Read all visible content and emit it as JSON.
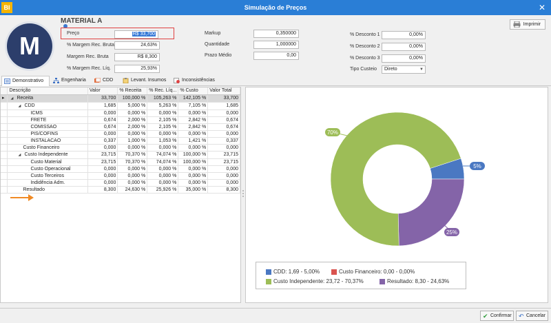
{
  "window": {
    "logo": "BI",
    "title": "Simulação de Preços",
    "close_glyph": "✕"
  },
  "product": {
    "avatar_letter": "M",
    "name": "MATERIAL A"
  },
  "fields": {
    "preco_label": "Preço",
    "preco_value": "R$ 33,700",
    "margem_bruta_pct_label": "% Margem Rec. Bruta",
    "margem_bruta_pct_value": "24,63%",
    "margem_bruta_label": "Margem Rec. Bruta",
    "margem_bruta_value": "R$ 8,300",
    "margem_liq_pct_label": "% Margem Rec. Líq.",
    "margem_liq_pct_value": "25,93%",
    "markup_label": "Markup",
    "markup_value": "0,350000",
    "quantidade_label": "Quantidade",
    "quantidade_value": "1,000000",
    "prazo_label": "Prazo Médio",
    "prazo_value": "0,00",
    "desc1_label": "% Desconto 1",
    "desc1_value": "0,00%",
    "desc2_label": "% Desconto 2",
    "desc2_value": "0,00%",
    "desc3_label": "% Desconto 3",
    "desc3_value": "0,00%",
    "tipo_custeio_label": "Tipo Custeio",
    "tipo_custeio_value": "Direto"
  },
  "toolbar": {
    "print_label": "Imprimir"
  },
  "tabs": [
    {
      "label": "Demonstrativo",
      "icon": "document-icon"
    },
    {
      "label": "Engenharia",
      "icon": "structure-icon"
    },
    {
      "label": "CDD",
      "icon": "cdd-icon"
    },
    {
      "label": "Levant. Insumos",
      "icon": "clipboard-icon"
    },
    {
      "label": "Inconsistências",
      "icon": "warning-doc-icon"
    }
  ],
  "table": {
    "headers": [
      "Descrição",
      "Valor",
      "% Receita",
      "% Rec. Líq...",
      "% Custo",
      "Valor Total"
    ],
    "rows": [
      {
        "level": 0,
        "expand": "◢",
        "cells": [
          "Receita",
          "33,700",
          "100,000 %",
          "105,263 %",
          "142,105 %",
          "33,700"
        ]
      },
      {
        "level": 1,
        "expand": "◢",
        "cells": [
          "CDD",
          "1,685",
          "5,000 %",
          "5,263 %",
          "7,105 %",
          "1,685"
        ]
      },
      {
        "level": 2,
        "expand": "",
        "cells": [
          "ICMS",
          "0,000",
          "0,000 %",
          "0,000 %",
          "0,000 %",
          "0,000"
        ]
      },
      {
        "level": 2,
        "expand": "",
        "cells": [
          "FRETE",
          "0,674",
          "2,000 %",
          "2,105 %",
          "2,842 %",
          "0,674"
        ]
      },
      {
        "level": 2,
        "expand": "",
        "cells": [
          "COMISSAO",
          "0,674",
          "2,000 %",
          "2,105 %",
          "2,842 %",
          "0,674"
        ]
      },
      {
        "level": 2,
        "expand": "",
        "cells": [
          "PIS/COFINS",
          "0,000",
          "0,000 %",
          "0,000 %",
          "0,000 %",
          "0,000"
        ]
      },
      {
        "level": 2,
        "expand": "",
        "cells": [
          "INSTALACAO",
          "0,337",
          "1,000 %",
          "1,053 %",
          "1,421 %",
          "0,337"
        ]
      },
      {
        "level": 1,
        "expand": "",
        "cells": [
          "Custo Financeiro",
          "0,000",
          "0,000 %",
          "0,000 %",
          "0,000 %",
          "0,000"
        ]
      },
      {
        "level": 1,
        "expand": "◢",
        "cells": [
          "Custo Independente",
          "23,715",
          "70,370 %",
          "74,074 %",
          "100,000 %",
          "23,715"
        ]
      },
      {
        "level": 2,
        "expand": "",
        "cells": [
          "Custo Material",
          "23,715",
          "70,370 %",
          "74,074 %",
          "100,000 %",
          "23,715"
        ]
      },
      {
        "level": 2,
        "expand": "",
        "cells": [
          "Custo Operacional",
          "0,000",
          "0,000 %",
          "0,000 %",
          "0,000 %",
          "0,000"
        ]
      },
      {
        "level": 2,
        "expand": "",
        "cells": [
          "Custo Terceiros",
          "0,000",
          "0,000 %",
          "0,000 %",
          "0,000 %",
          "0,000"
        ]
      },
      {
        "level": 2,
        "expand": "",
        "cells": [
          "Indidência Adm.",
          "0,000",
          "0,000 %",
          "0,000 %",
          "0,000 %",
          "0,000"
        ]
      },
      {
        "level": 1,
        "expand": "",
        "cells": [
          "Resultado",
          "8,300",
          "24,630 %",
          "25,926 %",
          "35,000 %",
          "8,300"
        ]
      }
    ]
  },
  "chart_data": {
    "type": "pie",
    "slices": [
      {
        "label": "CDD",
        "value": 5.0,
        "display": "5%",
        "color": "#4a78c2"
      },
      {
        "label": "Custo Financeiro",
        "value": 0.0,
        "display": "",
        "color": "#d9534f"
      },
      {
        "label": "Custo Independente",
        "value": 70.37,
        "display": "70%",
        "color": "#9dbd57"
      },
      {
        "label": "Resultado",
        "value": 24.63,
        "display": "25%",
        "color": "#8464a8"
      }
    ],
    "legend": [
      {
        "text": "CDD: 1,69 - 5,00%",
        "color": "#4a78c2"
      },
      {
        "text": "Custo Financeiro: 0,00 - 0,00%",
        "color": "#d9534f"
      },
      {
        "text": "Custo Independente: 23,72 - 70,37%",
        "color": "#9dbd57"
      },
      {
        "text": "Resultado: 8,30 - 24,63%",
        "color": "#8464a8"
      }
    ]
  },
  "footer": {
    "confirm_label": "Confirmar",
    "cancel_label": "Cancelar"
  }
}
